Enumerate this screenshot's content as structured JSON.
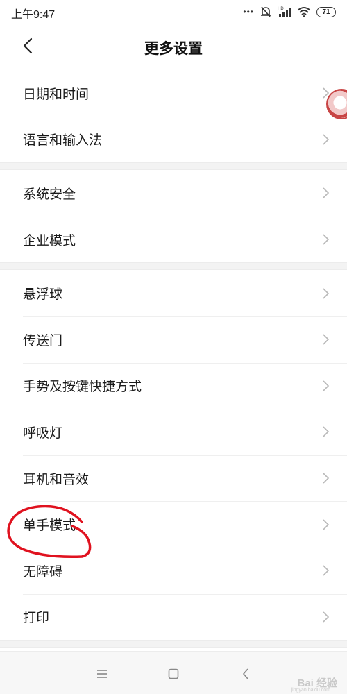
{
  "status_bar": {
    "time": "上午9:47",
    "battery": "71",
    "dots": "•••"
  },
  "header": {
    "title": "更多设置"
  },
  "groups": [
    {
      "items": [
        {
          "label": "日期和时间"
        },
        {
          "label": "语言和输入法"
        }
      ]
    },
    {
      "items": [
        {
          "label": "系统安全"
        },
        {
          "label": "企业模式"
        }
      ]
    },
    {
      "items": [
        {
          "label": "悬浮球"
        },
        {
          "label": "传送门"
        },
        {
          "label": "手势及按键快捷方式"
        },
        {
          "label": "呼吸灯"
        },
        {
          "label": "耳机和音效"
        },
        {
          "label": "单手模式"
        },
        {
          "label": "无障碍"
        },
        {
          "label": "打印"
        }
      ]
    }
  ],
  "watermark": {
    "text": "Bai 经验",
    "sub": "jingyan.baidu.com"
  },
  "icons": {
    "back": "chevron-left-icon",
    "item_arrow": "chevron-right-icon",
    "menu": "menu-icon",
    "home": "square-home-icon",
    "nav_back": "nav-back-icon"
  },
  "colors": {
    "annotation": "#e0121f",
    "divider": "#efefef",
    "group_gap": "#f3f3f3"
  }
}
